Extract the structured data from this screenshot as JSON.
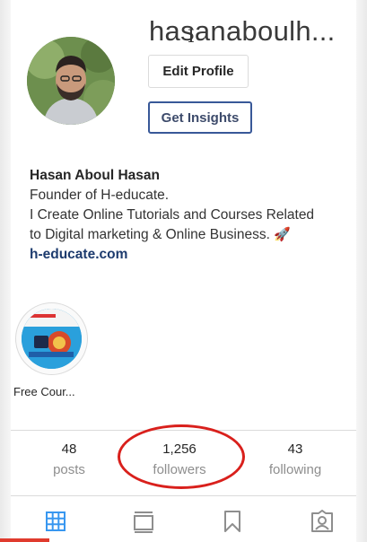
{
  "profile": {
    "username": "hasanaboulh...",
    "edit_profile_label": "Edit Profile",
    "insights_label": "Get Insights"
  },
  "bio": {
    "name": "Hasan Aboul Hasan",
    "line1": "Founder of H-educate.",
    "line2": "I Create Online Tutorials and Courses Related",
    "line3": "to Digital marketing & Online Business.",
    "emoji": "🚀",
    "link": "h-educate.com"
  },
  "highlights": [
    {
      "label": "Free Cour..."
    }
  ],
  "stats": {
    "posts": {
      "value": "48",
      "label": "posts"
    },
    "followers": {
      "value": "1,256",
      "label": "followers"
    },
    "following": {
      "value": "43",
      "label": "following"
    }
  },
  "colors": {
    "insights_border": "#385898",
    "annotation_circle": "#d9201c",
    "active_tab": "#3897f0",
    "inactive_tab": "#8e8e8e"
  },
  "icons": [
    "grid-icon",
    "feed-icon",
    "bookmark-icon",
    "tagged-icon"
  ]
}
